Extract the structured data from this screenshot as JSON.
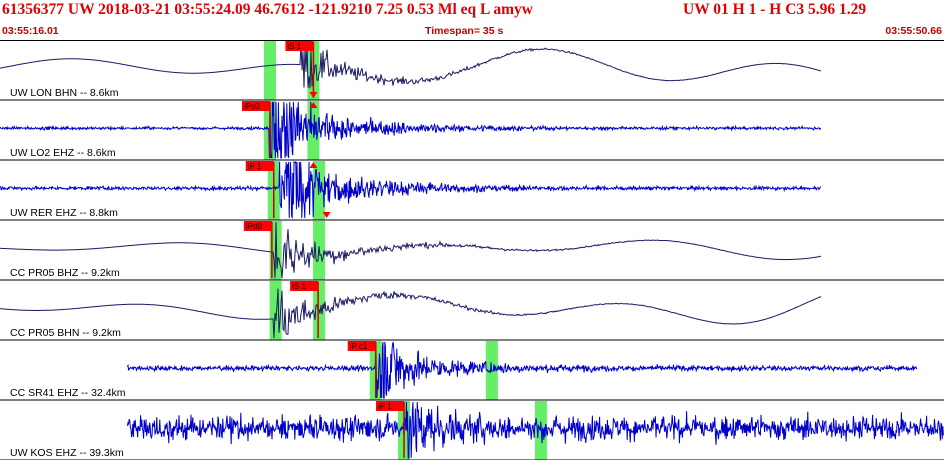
{
  "header": {
    "event_info": "61356377 UW 2018-03-21 03:55:24.09   46.7612 -121.9210   7.25  0.53 Ml  eq  L amyw",
    "selected_channel": "UW 01  H   1  -  H C3    5.96  1.29"
  },
  "time_bar": {
    "start": "03:55:16.01",
    "timespan": "Timespan=  35 s",
    "end": "03:55:50.66"
  },
  "colors": {
    "header_text": "#e00000",
    "trace": "#0000cc",
    "trace_dark": "#1a1a66",
    "pick_band": "#66ee66",
    "pick_tag": "#ff0000",
    "pick_line": "#cc0000",
    "separator": "#000000"
  },
  "panels": [
    {
      "label": "UW LON BHN -- 8.6km",
      "trace": {
        "start": 0.0,
        "end": 0.87,
        "style": "smooth",
        "color": "dark",
        "amp": 0.25,
        "onset": 0.318,
        "burst": 0.55
      },
      "bands": [
        0.286,
        0.332
      ],
      "picks": [
        {
          "tag": "iS 1",
          "pos": 0.332,
          "tag_side": "left"
        }
      ],
      "markers": [
        {
          "pos": 0.332,
          "dir": "down"
        }
      ]
    },
    {
      "label": "UW LO2 EHZ -- 8.6km",
      "trace": {
        "start": 0.0,
        "end": 0.87,
        "style": "noise",
        "color": "blue",
        "amp": 0.04,
        "onset": 0.285,
        "burst": 0.75
      },
      "bands": [
        0.286,
        0.332
      ],
      "picks": [
        {
          "tag": "iPc0",
          "pos": 0.286,
          "tag_side": "left"
        }
      ],
      "markers": [
        {
          "pos": 0.332,
          "dir": "up"
        }
      ]
    },
    {
      "label": "UW RER EHZ -- 8.8km",
      "trace": {
        "start": 0.0,
        "end": 0.87,
        "style": "noise",
        "color": "blue",
        "amp": 0.05,
        "onset": 0.295,
        "burst": 0.8
      },
      "bands": [
        0.29,
        0.338
      ],
      "picks": [
        {
          "tag": "iP 1",
          "pos": 0.29,
          "tag_side": "left"
        }
      ],
      "markers": [
        {
          "pos": 0.332,
          "dir": "up"
        },
        {
          "pos": 0.346,
          "dir": "down"
        }
      ]
    },
    {
      "label": "CC PR05 BHZ -- 9.2km",
      "trace": {
        "start": 0.0,
        "end": 0.87,
        "style": "smooth",
        "color": "dark",
        "amp": 0.12,
        "onset": 0.29,
        "burst": 0.7
      },
      "bands": [
        0.292,
        0.338
      ],
      "picks": [
        {
          "tag": "iPd0",
          "pos": 0.288,
          "tag_side": "left"
        }
      ],
      "markers": []
    },
    {
      "label": "CC PR05 BHN -- 9.2km",
      "trace": {
        "start": 0.0,
        "end": 0.87,
        "style": "smooth",
        "color": "dark",
        "amp": 0.22,
        "onset": 0.29,
        "burst": 0.65
      },
      "bands": [
        0.292,
        0.338
      ],
      "picks": [
        {
          "tag": "iS 1",
          "pos": 0.337,
          "tag_side": "left"
        }
      ],
      "markers": []
    },
    {
      "label": "CC SR41 EHZ -- 32.4km",
      "trace": {
        "start": 0.135,
        "end": 0.972,
        "style": "noise",
        "color": "blue",
        "amp": 0.07,
        "onset": 0.398,
        "burst": 0.55
      },
      "bands": [
        0.398,
        0.521
      ],
      "picks": [
        {
          "tag": "iP c1",
          "pos": 0.398,
          "tag_side": "left"
        }
      ],
      "markers": []
    },
    {
      "label": "UW KOS EHZ -- 39.3km",
      "trace": {
        "start": 0.135,
        "end": 1.0,
        "style": "noise",
        "color": "blue",
        "amp": 0.35,
        "onset": 0.43,
        "burst": 0.45
      },
      "bands": [
        0.428,
        0.573
      ],
      "picks": [
        {
          "tag": "iP 1",
          "pos": 0.428,
          "tag_side": "left"
        }
      ],
      "markers": []
    }
  ]
}
